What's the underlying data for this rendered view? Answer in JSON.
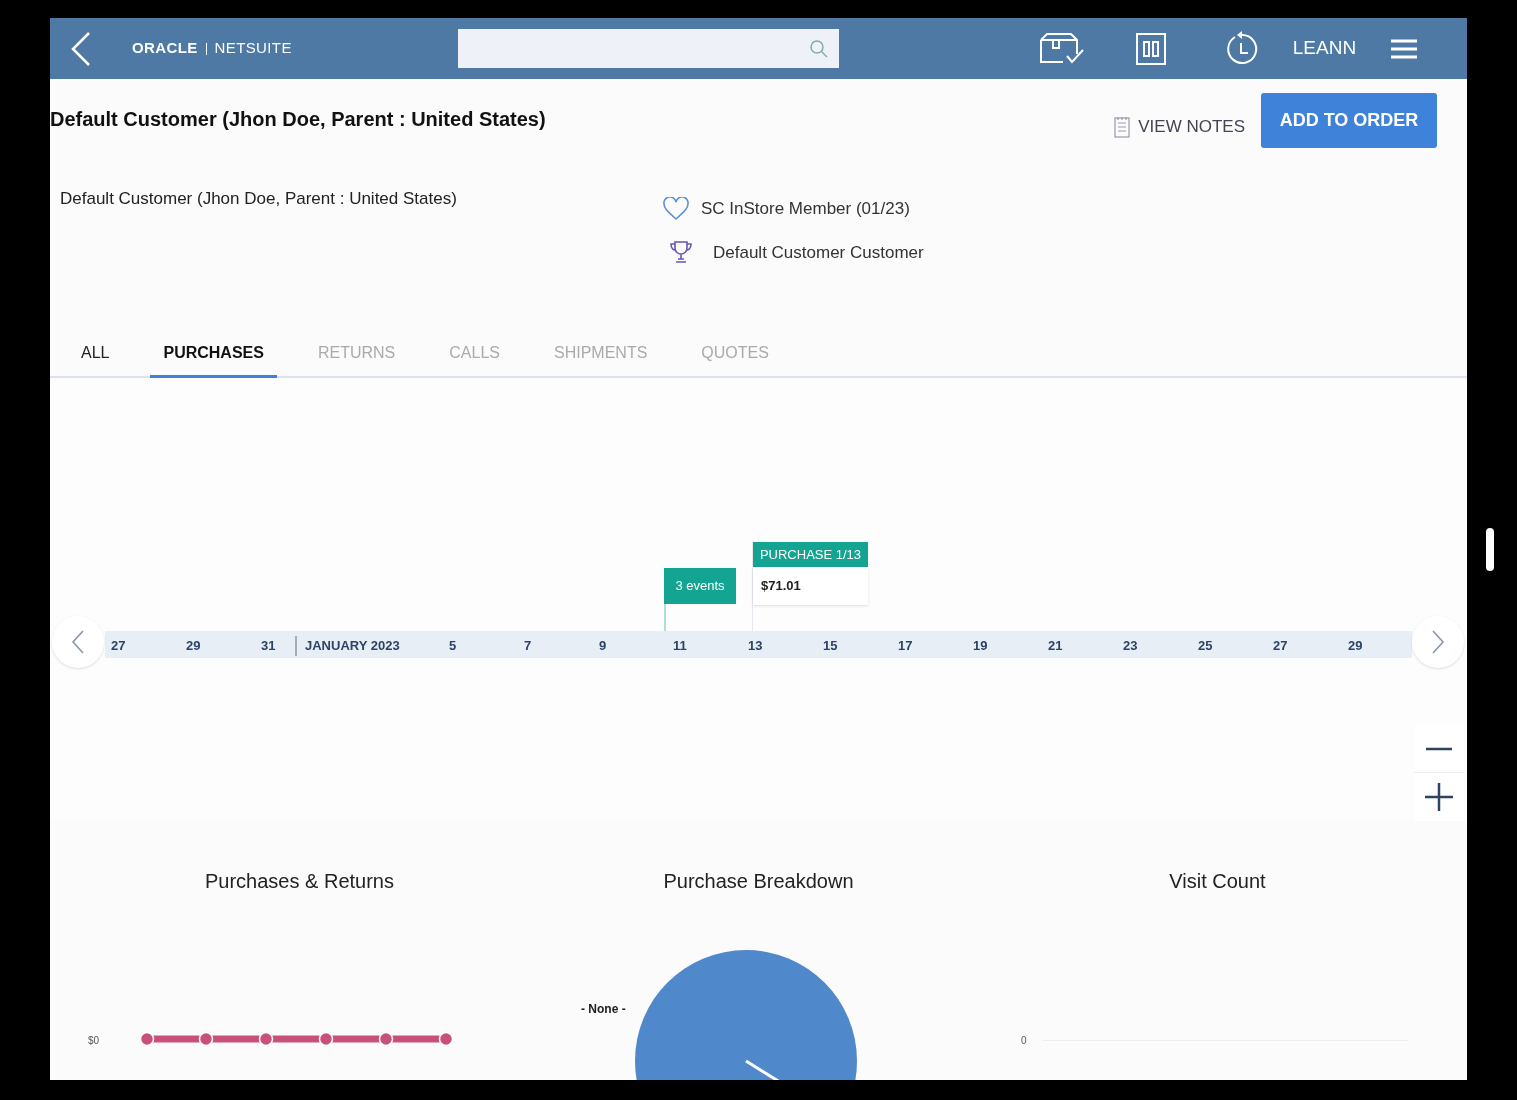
{
  "header": {
    "logo": {
      "brand": "ORACLE",
      "product": "NETSUITE"
    },
    "user": "LEANN"
  },
  "customer": {
    "title": "Default Customer (Jhon Doe, Parent : United States)",
    "name": "Default Customer (Jhon Doe, Parent : United States)",
    "membership": "SC InStore Member (01/23)",
    "tier": "Default Customer Customer"
  },
  "actions": {
    "view_notes": "VIEW NOTES",
    "add_to_order": "ADD TO ORDER"
  },
  "tabs": [
    {
      "label": "ALL",
      "selected": false,
      "disabled": false
    },
    {
      "label": "PURCHASES",
      "selected": true,
      "disabled": false
    },
    {
      "label": "RETURNS",
      "selected": false,
      "disabled": true
    },
    {
      "label": "CALLS",
      "selected": false,
      "disabled": true
    },
    {
      "label": "SHIPMENTS",
      "selected": false,
      "disabled": true
    },
    {
      "label": "QUOTES",
      "selected": false,
      "disabled": true
    }
  ],
  "timeline": {
    "dates": [
      {
        "label": "27",
        "kind": "day"
      },
      {
        "label": "29",
        "kind": "day"
      },
      {
        "label": "31",
        "kind": "day"
      },
      {
        "label": "JANUARY 2023",
        "kind": "month"
      },
      {
        "label": "5",
        "kind": "day"
      },
      {
        "label": "7",
        "kind": "day"
      },
      {
        "label": "9",
        "kind": "day"
      },
      {
        "label": "11",
        "kind": "day"
      },
      {
        "label": "13",
        "kind": "day"
      },
      {
        "label": "15",
        "kind": "day"
      },
      {
        "label": "17",
        "kind": "day"
      },
      {
        "label": "19",
        "kind": "day"
      },
      {
        "label": "21",
        "kind": "day"
      },
      {
        "label": "23",
        "kind": "day"
      },
      {
        "label": "25",
        "kind": "day"
      },
      {
        "label": "27",
        "kind": "day"
      },
      {
        "label": "29",
        "kind": "day"
      }
    ],
    "events": [
      {
        "kind": "group",
        "label": "3 events"
      },
      {
        "kind": "purchase",
        "label": "PURCHASE 1/13",
        "amount": "$71.01"
      }
    ]
  },
  "charts": [
    {
      "title": "Purchases & Returns",
      "kind": "line",
      "axis_label": "$0"
    },
    {
      "title": "Purchase Breakdown",
      "kind": "pie",
      "slice_label": "- None -"
    },
    {
      "title": "Visit Count",
      "kind": "empty",
      "axis_label": "0"
    }
  ]
}
